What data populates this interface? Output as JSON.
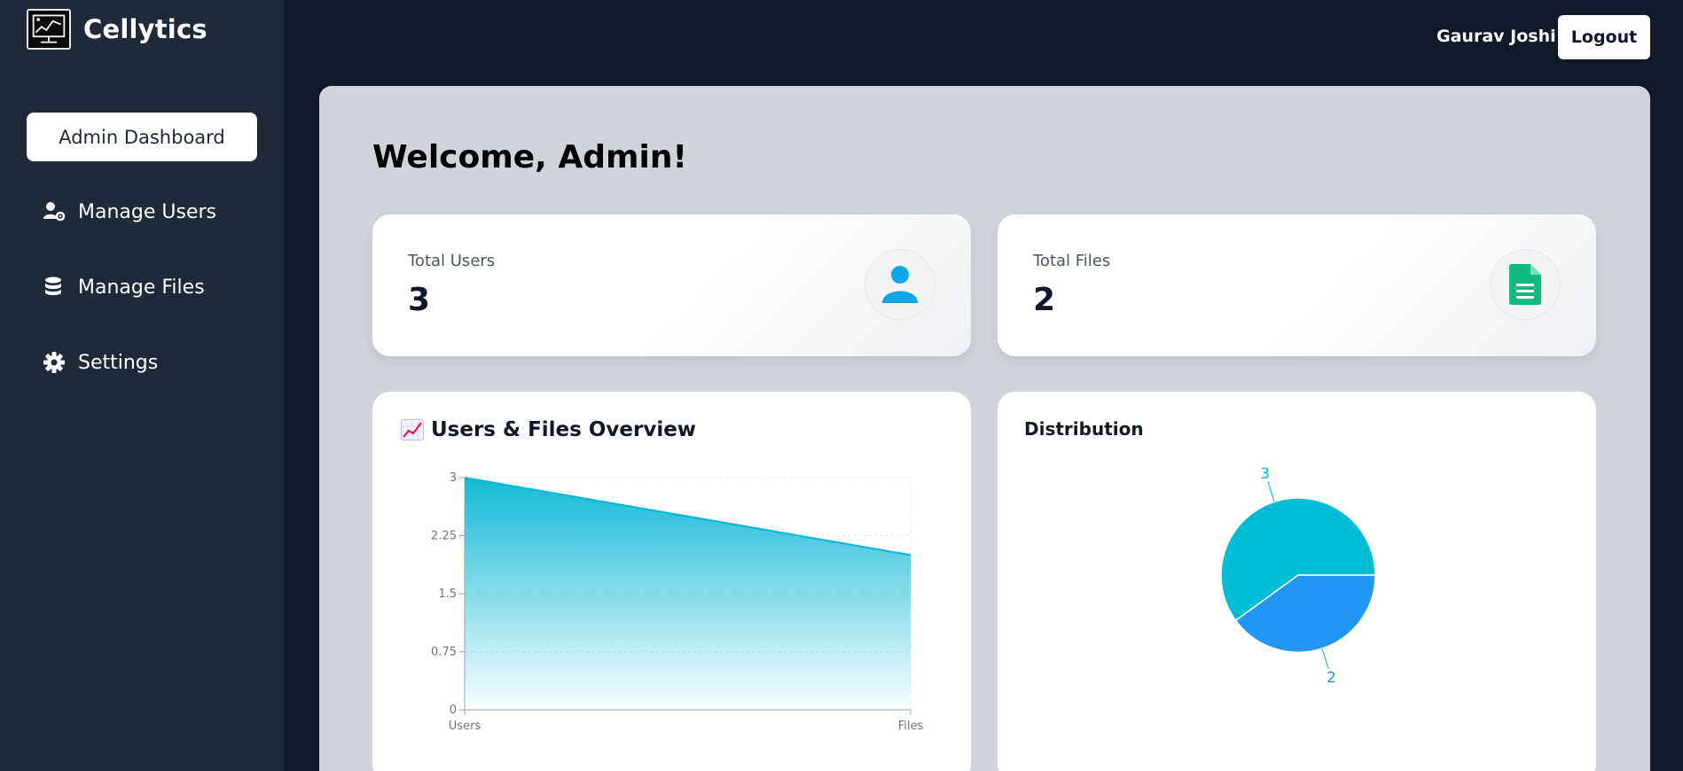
{
  "app": {
    "name": "Cellytics"
  },
  "sidebar": {
    "active_label": "Admin Dashboard",
    "items": [
      {
        "label": "Manage Users",
        "icon": "user-gear-icon"
      },
      {
        "label": "Manage Files",
        "icon": "database-icon"
      },
      {
        "label": "Settings",
        "icon": "gear-icon"
      }
    ]
  },
  "header": {
    "user_name": "Gaurav Joshi",
    "logout_label": "Logout"
  },
  "main": {
    "welcome": "Welcome, Admin!",
    "stats": [
      {
        "label": "Total Users",
        "value": "3",
        "icon": "user-icon",
        "color": "#0ea5e9"
      },
      {
        "label": "Total Files",
        "value": "2",
        "icon": "file-icon",
        "color": "#10b981"
      }
    ],
    "overview_title": "Users & Files Overview",
    "distribution_title": "Distribution"
  },
  "chart_data": [
    {
      "type": "area",
      "title": "Users & Files Overview",
      "categories": [
        "Users",
        "Files"
      ],
      "values": [
        3,
        2
      ],
      "yticks": [
        "0",
        "0.75",
        "1.5",
        "2.25",
        "3"
      ],
      "ylim": [
        0,
        3
      ],
      "grid": true,
      "color": "#06b6d4"
    },
    {
      "type": "pie",
      "title": "Distribution",
      "values": [
        3,
        2
      ],
      "labels": [
        "3",
        "2"
      ],
      "colors": [
        "#00bcd4",
        "#2196f3"
      ]
    }
  ]
}
